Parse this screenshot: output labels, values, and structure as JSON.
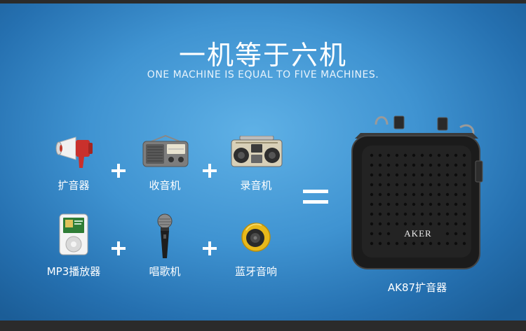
{
  "title": "一机等于六机",
  "subtitle": "ONE MACHINE IS EQUAL TO FIVE MACHINES.",
  "items": [
    {
      "label": "扩音器",
      "icon": "megaphone-icon"
    },
    {
      "label": "收音机",
      "icon": "radio-icon"
    },
    {
      "label": "录音机",
      "icon": "boombox-icon"
    },
    {
      "label": "MP3播放器",
      "icon": "mp3-player-icon"
    },
    {
      "label": "唱歌机",
      "icon": "microphone-icon"
    },
    {
      "label": "蓝牙音响",
      "icon": "bluetooth-speaker-icon"
    }
  ],
  "product": {
    "label": "AK87扩音器",
    "brand": "AKER"
  },
  "colors": {
    "background": "#3f93d1",
    "bar": "#2b2b2b",
    "text": "#ffffff"
  }
}
